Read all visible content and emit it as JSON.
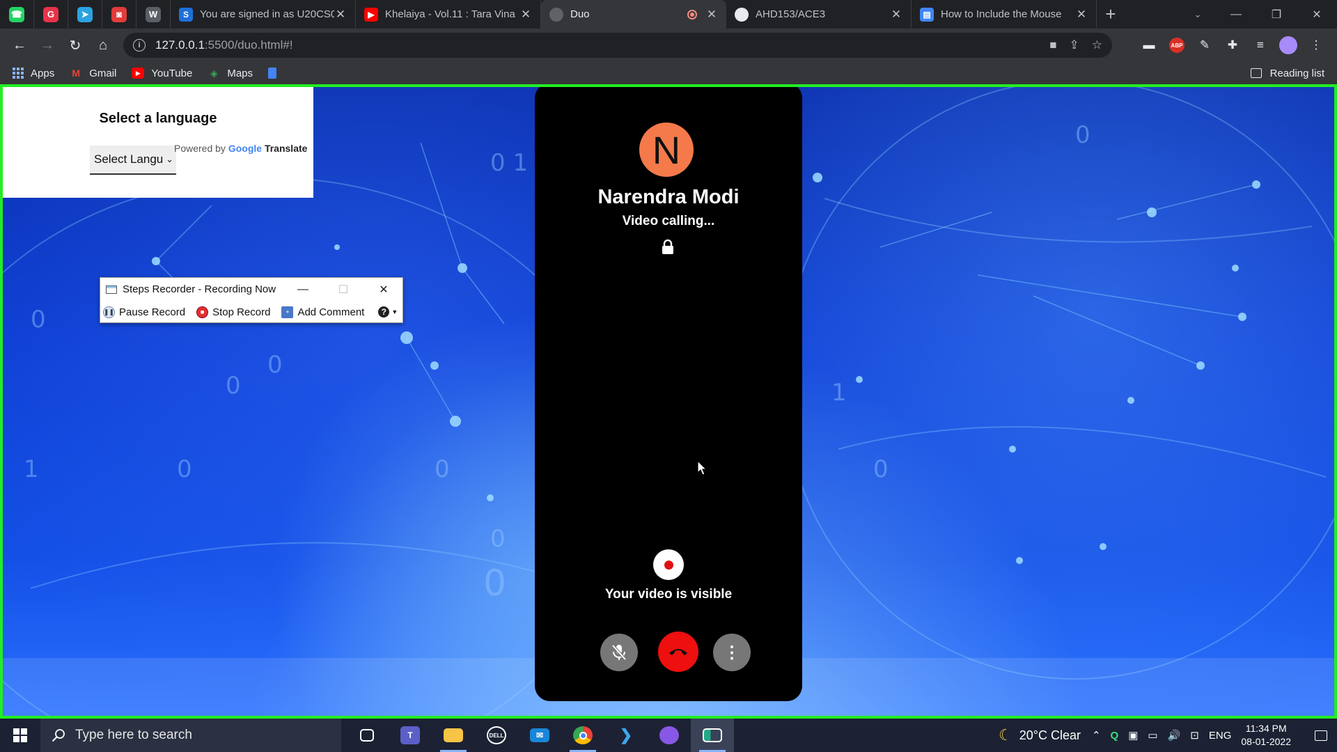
{
  "browser": {
    "pinned_tabs": [
      {
        "name": "whatsapp-icon",
        "color": "#25d366",
        "glyph": "☎"
      },
      {
        "name": "grammarly-icon",
        "color": "#e8334a",
        "glyph": "G"
      },
      {
        "name": "telegram-icon",
        "color": "#2aa3e0",
        "glyph": "➤"
      },
      {
        "name": "app-icon",
        "color": "#e23b3b",
        "glyph": "◙"
      },
      {
        "name": "wordpress-icon",
        "color": "#5a5f66",
        "glyph": "W"
      }
    ],
    "tabs": [
      {
        "title": "You are signed in as U20CS0",
        "favicon": "S",
        "favicon_color": "#1e6fd9"
      },
      {
        "title": "Khelaiya - Vol.11 : Tara Vina",
        "favicon": "▶",
        "favicon_color": "#ff0000"
      },
      {
        "title": "Duo",
        "favicon": "🌐",
        "favicon_color": "#5f6368",
        "active": true
      },
      {
        "title": "AHD153/ACE3",
        "favicon": "⚫",
        "favicon_color": "#111"
      },
      {
        "title": "How to Include the Mouse",
        "favicon": "▤",
        "favicon_color": "#4285f4"
      }
    ],
    "close_glyph": "✕",
    "new_tab_glyph": "+",
    "url_host": "127.0.0.1",
    "url_path": ":5500/duo.html#!",
    "bookmarks": [
      {
        "label": "Apps",
        "icon": "apps-grid-icon"
      },
      {
        "label": "Gmail",
        "icon": "gmail-icon"
      },
      {
        "label": "YouTube",
        "icon": "youtube-icon"
      },
      {
        "label": "Maps",
        "icon": "maps-icon"
      }
    ],
    "reading_list": "Reading list"
  },
  "translate": {
    "title": "Select a language",
    "select_value": "Select Langu",
    "powered_by": "Powered by",
    "google": "Google",
    "translate_word": "Translate"
  },
  "steps_recorder": {
    "title": "Steps Recorder - Recording Now",
    "pause": "Pause Record",
    "stop": "Stop Record",
    "add_comment": "Add Comment",
    "help": "?"
  },
  "call": {
    "avatar_letter": "N",
    "avatar_color": "#f47a4b",
    "caller_name": "Narendra Modi",
    "status": "Video calling...",
    "video_status": "Your video is visible",
    "hangup_color": "#ee0f0f"
  },
  "taskbar": {
    "search_placeholder": "Type here to search",
    "temperature": "20°C",
    "weather": "Clear",
    "language": "ENG",
    "time": "11:34 PM",
    "date": "08-01-2022"
  }
}
